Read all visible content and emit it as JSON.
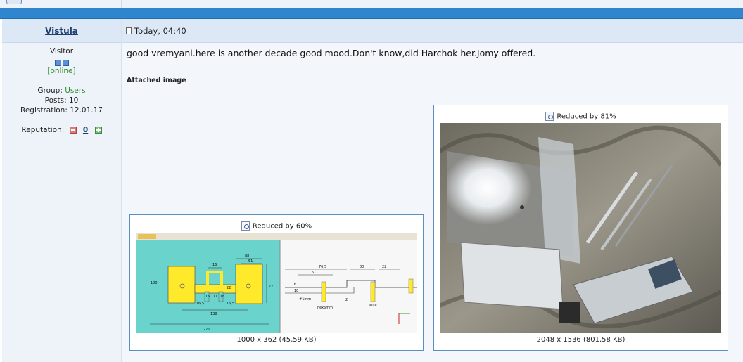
{
  "post": {
    "author": "Vistula",
    "date": "Today, 04:40",
    "message": "good vremyani.here is another decade good mood.Don't know,did Harchok her.Jomy offered.",
    "attached_label": "Attached image"
  },
  "profile": {
    "rank": "Visitor",
    "status": "[online]",
    "group_label": "Group:",
    "group_value": "Users",
    "posts": "Posts: 10",
    "registration": "Registration: 12.01.17",
    "reputation_label": "Reputation:",
    "reputation_value": "0"
  },
  "attachments": [
    {
      "caption": "Reduced by 60%",
      "size": "1000 x 362 (45,59 KB)"
    },
    {
      "caption": "Reduced by 81%",
      "size": "2048 x 1536 (801,58 KB)"
    }
  ],
  "drawing_labels": {
    "d88": "88",
    "d51": "51",
    "d16a": "16",
    "d22": "22",
    "d16b": "16",
    "d11": "11",
    "d16c": "16",
    "d165a": "16,5",
    "d165b": "16,5",
    "d100": "100",
    "d77": "77",
    "d138": "138",
    "d270": "270",
    "d765": "76,5",
    "d80": "80",
    "d22b": "22",
    "d51b": "51",
    "d6": "6",
    "d18": "18",
    "d1mm": "#1mm",
    "d2": "2",
    "dhex": "hex6mm",
    "dsma": "sma"
  },
  "colors": {
    "bar_blue": "#2f86cf",
    "link": "#1d3f6e",
    "green": "#2e8b2e"
  }
}
